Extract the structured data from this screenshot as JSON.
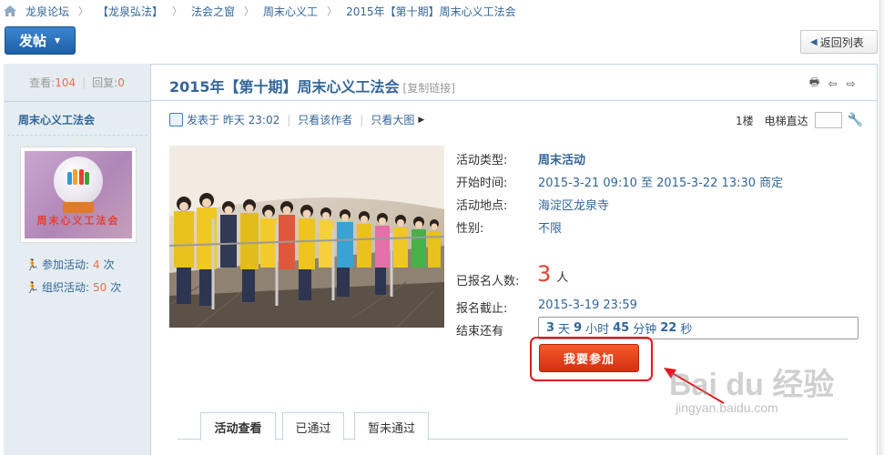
{
  "breadcrumb": [
    "龙泉论坛",
    "【龙泉弘法】",
    "法会之窗",
    "周末心义工",
    "2015年【第十期】周末心义工法会"
  ],
  "toolbar": {
    "post_label": "发帖",
    "back_label": "返回列表"
  },
  "sidebar": {
    "views_label": "查看:",
    "views": "104",
    "replies_label": "回复:",
    "replies": "0",
    "author": "周末心义工法会",
    "avatar_text": "周末心义工法会",
    "joined_label": "参加活动:",
    "joined_value": "4",
    "organized_label": "组织活动:",
    "organized_value": "50",
    "unit": "次"
  },
  "thread": {
    "title": "2015年【第十期】周末心义工法会",
    "copy_link": "[复制链接]",
    "posted": "发表于 昨天 23:02",
    "author_only": "只看该作者",
    "big_image": "只看大图",
    "floor": "1楼",
    "elevator": "电梯直达"
  },
  "activity": {
    "type_label": "活动类型:",
    "type_value": "周末活动",
    "start_label": "开始时间:",
    "start_value": "2015-3-21 09:10 至 2015-3-22 13:30 商定",
    "place_label": "活动地点:",
    "place_value": "海淀区龙泉寺",
    "gender_label": "性别:",
    "gender_value": "不限",
    "enrolled_label": "已报名人数:",
    "enrolled_value": "3",
    "enrolled_unit": "人",
    "deadline_label": "报名截止:",
    "deadline_value": "2015-3-19 23:59",
    "remaining_label": "结束还有",
    "cd_days": "3",
    "cd_days_unit": "天",
    "cd_hours": "9",
    "cd_hours_unit": "小时",
    "cd_minutes": "45",
    "cd_minutes_unit": "分钟",
    "cd_seconds": "22",
    "cd_seconds_unit": "秒",
    "join_label": "我要参加"
  },
  "tabs": [
    "活动查看",
    "已通过",
    "暂未通过"
  ],
  "watermark": {
    "brand": "Bai du 经验",
    "url": "jingyan.baidu.com"
  },
  "colors": {
    "link": "#336699",
    "accent": "#f26c4f",
    "join": "#e4402f",
    "sidebar": "#e5edf2"
  }
}
